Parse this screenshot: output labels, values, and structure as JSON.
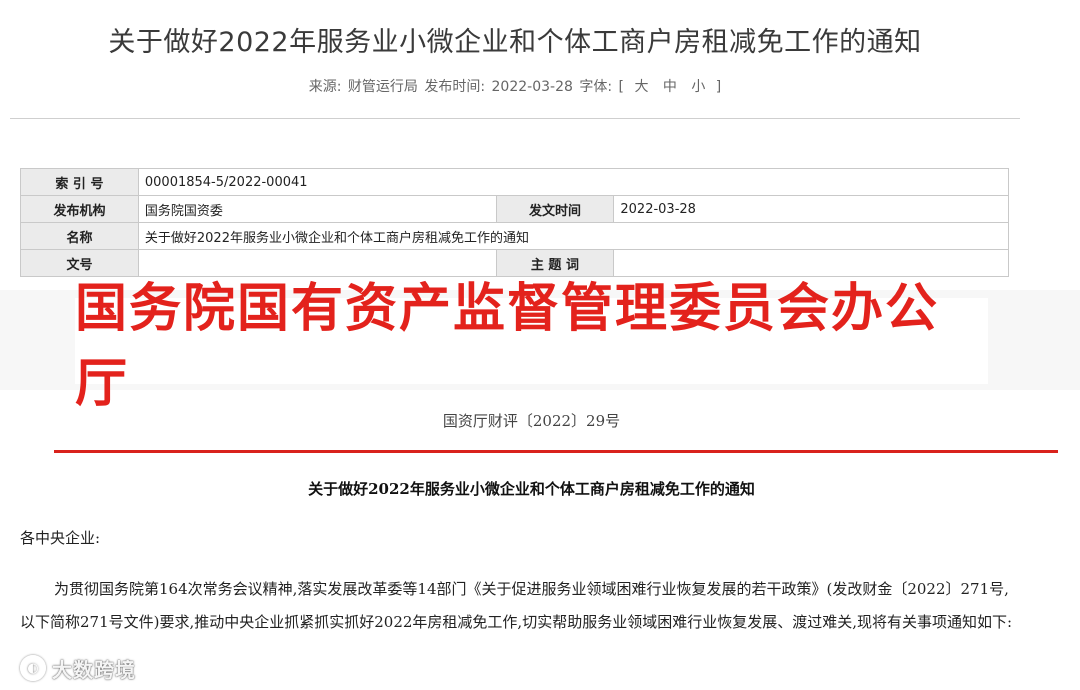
{
  "article": {
    "title": "关于做好2022年服务业小微企业和个体工商户房租减免工作的通知",
    "meta": {
      "source_label": "来源:",
      "source_value": "财管运行局",
      "publish_label": "发布时间:",
      "publish_value": "2022-03-28",
      "font_label": "字体:",
      "bracket_open": "[",
      "size_large": "大",
      "size_medium": "中",
      "size_small": "小",
      "bracket_close": "]"
    }
  },
  "info_table": {
    "index_label": "索 引 号",
    "index_value": "00001854-5/2022-00041",
    "org_label": "发布机构",
    "org_value": "国务院国资委",
    "date_label": "发文时间",
    "date_value": "2022-03-28",
    "name_label": "名称",
    "name_value": "关于做好2022年服务业小微企业和个体工商户房租减免工作的通知",
    "docno_label": "文号",
    "docno_value": "",
    "subject_label": "主 题 词",
    "subject_value": ""
  },
  "document": {
    "header": "国务院国有资产监督管理委员会办公厅",
    "doc_number": "国资厅财评〔2022〕29号",
    "notice_title": "关于做好2022年服务业小微企业和个体工商户房租减免工作的通知",
    "salutation": "各中央企业:",
    "paragraph_1": "为贯彻国务院第164次常务会议精神,落实发展改革委等14部门《关于促进服务业领域困难行业恢复发展的若干政策》(发改财金〔2022〕271号,以下简称271号文件)要求,推动中央企业抓紧抓实抓好2022年房租减免工作,切实帮助服务业领域困难行业恢复发展、渡过难关,现将有关事项通知如下:"
  },
  "watermark": {
    "text": "大数跨境"
  },
  "colors": {
    "accent_red": "#e3221c",
    "rule_red": "#d9221c",
    "table_label_bg": "#ebebeb"
  }
}
